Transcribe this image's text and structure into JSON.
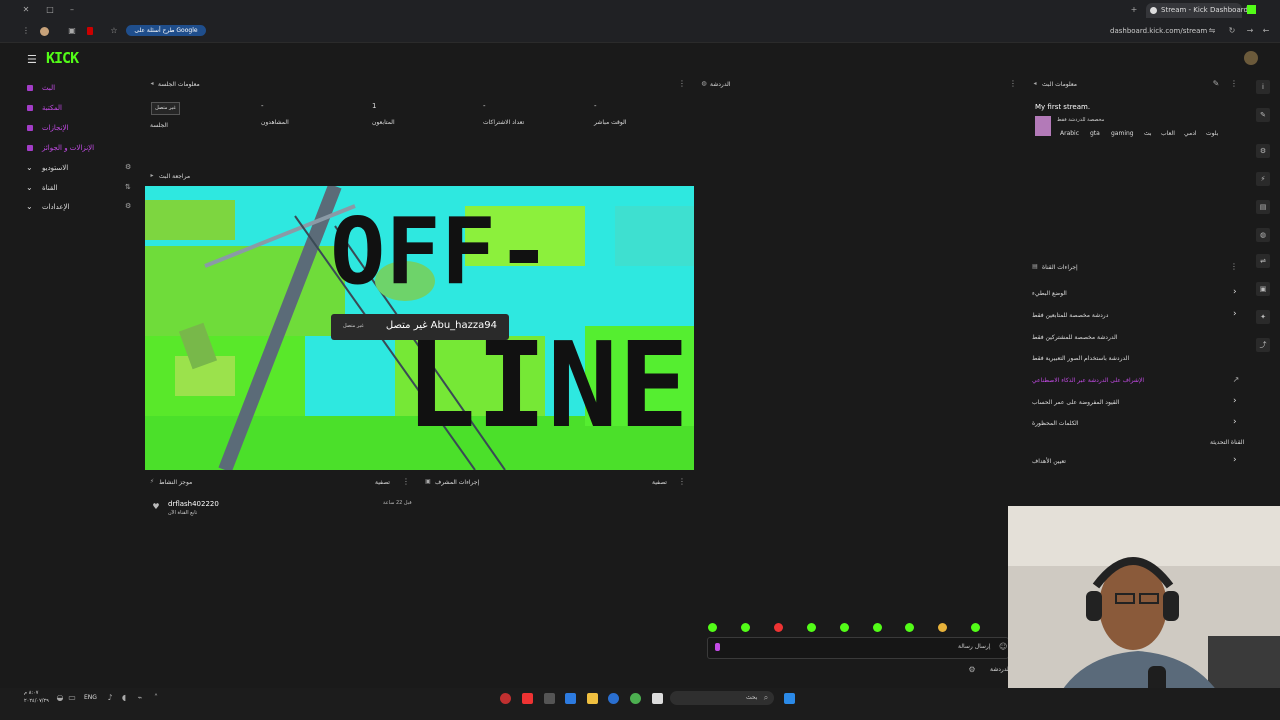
{
  "browser": {
    "tab_title": "Stream - Kick Dashboard",
    "address": "dashboard.kick.com/stream",
    "pill_label": "طرح أسئلة على Google"
  },
  "app": {
    "logo": "KICK",
    "brand_color": "#53fc18",
    "accent_color": "#c44be7"
  },
  "sidebar": {
    "items": [
      {
        "label": "البث",
        "icon": "broadcast-icon"
      },
      {
        "label": "المكتبة",
        "icon": "library-icon"
      },
      {
        "label": "الإنجازات",
        "icon": "trophy-icon"
      },
      {
        "label": "الإنزالات و الجوائز",
        "icon": "gift-icon"
      }
    ],
    "sections": [
      {
        "label": "الاستوديو"
      },
      {
        "label": "القناة"
      },
      {
        "label": "الإعدادات"
      }
    ]
  },
  "session": {
    "title": "معلومات الجلسة",
    "badge": "غير متصل",
    "stats": [
      {
        "value": "-",
        "label": "الجلسة"
      },
      {
        "value": "-",
        "label": "المشاهدون"
      },
      {
        "value": "1",
        "label": "المتابعون"
      },
      {
        "value": "-",
        "label": "تعداد الاشتراكات"
      },
      {
        "value": "-",
        "label": "الوقت مباشر"
      }
    ]
  },
  "chat_panel": {
    "title": "الدردشة"
  },
  "preview": {
    "title": "مراجعة البث",
    "offline_line1": "OFF-",
    "offline_line2": "LINE",
    "tooltip_name": "غير متصل Abu_hazza94",
    "tooltip_sub": "غير متصل"
  },
  "activity": {
    "title": "موجز النشاط",
    "filter": "تصفية",
    "user": "drflash402220",
    "sub": "تابع القناة الآن",
    "time": "قبل 22 ساعة"
  },
  "mod_actions": {
    "title": "إجراءات المشرف",
    "filter": "تصفية"
  },
  "stream_info": {
    "title": "معلومات البث",
    "stream_title": "My first stream.",
    "category": "مخصصة للدردشة فقط",
    "tags": [
      "Arabic",
      "gta",
      "gaming",
      "بث",
      "العاب",
      "ادمي",
      "بلوت"
    ]
  },
  "channel_actions": {
    "title": "إجراءات القناة",
    "items": [
      {
        "label": "الوضع البطيء",
        "chevron": true,
        "link": false
      },
      {
        "label": "دردشة مخصصة للمتابعين فقط",
        "chevron": true,
        "link": false
      },
      {
        "label": "الدردشة مخصصة للمشتركين فقط",
        "chevron": false,
        "link": false
      },
      {
        "label": "الدردشة باستخدام الصور التعبيرية فقط",
        "chevron": false,
        "link": false
      },
      {
        "label": "الإشراف على الدردشة عبر الذكاء الاصطناعي",
        "chevron": false,
        "link": true
      },
      {
        "label": "القيود المفروضة على عمر الحساب",
        "chevron": true,
        "link": false
      },
      {
        "label": "الكلمات المحظورة",
        "chevron": true,
        "link": false
      },
      {
        "label": "القناة التحديثة",
        "chevron": false,
        "link": false
      },
      {
        "label": "تعيين الأهداف",
        "chevron": true,
        "link": false
      }
    ]
  },
  "chat_input": {
    "placeholder": "إرسال رسالة",
    "send_label": "الدردشة"
  },
  "taskbar": {
    "search_placeholder": "بحث",
    "lang": "ENG",
    "time": "٨:٠٧ م",
    "date": "٢٠٢٤/٠٧/٢٩"
  }
}
